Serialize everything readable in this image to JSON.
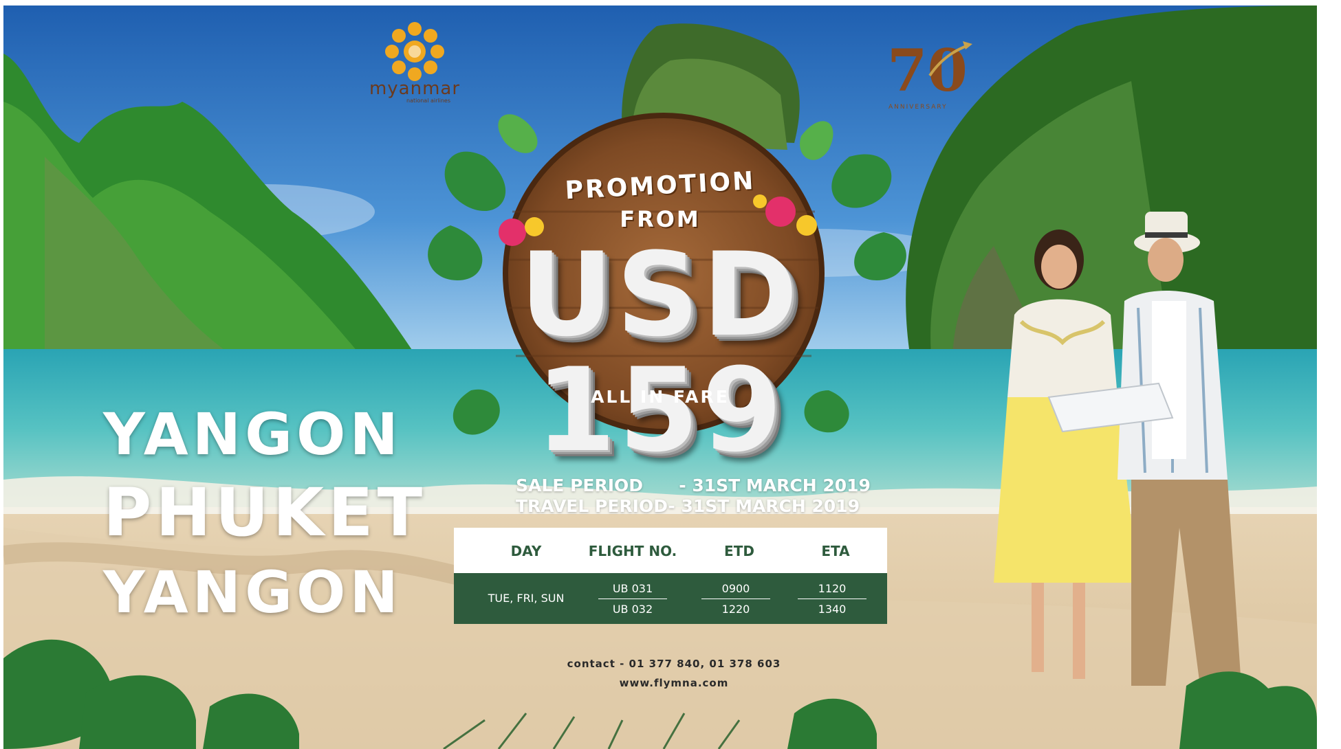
{
  "logos": {
    "airline_name": "myanmar",
    "airline_sub": "national airlines",
    "anniversary_number": "70",
    "anniversary_text": "ANNIVERSARY"
  },
  "promo": {
    "line1": "PROMOTION",
    "line2": "FROM",
    "price": "USD 159",
    "fare_note": "ALL IN FARE"
  },
  "route": [
    "YANGON",
    "PHUKET",
    "YANGON"
  ],
  "periods": {
    "sale": "SALE PERIOD      - 31ST MARCH 2019",
    "travel": "TRAVEL PERIOD- 31ST MARCH 2019"
  },
  "schedule": {
    "headers": [
      "DAY",
      "FLIGHT NO.",
      "ETD",
      "ETA"
    ],
    "day": "TUE, FRI, SUN",
    "rows": [
      {
        "flight": "UB 031",
        "etd": "0900",
        "eta": "1120"
      },
      {
        "flight": "UB 032",
        "etd": "1220",
        "eta": "1340"
      }
    ]
  },
  "contact": {
    "phone": "contact - 01 377 840, 01 378 603",
    "website": "www.flymna.com"
  },
  "colors": {
    "table_green": "#2e5b3d",
    "logo_gold": "#f0a820",
    "logo_brown": "#6b3a1e"
  }
}
